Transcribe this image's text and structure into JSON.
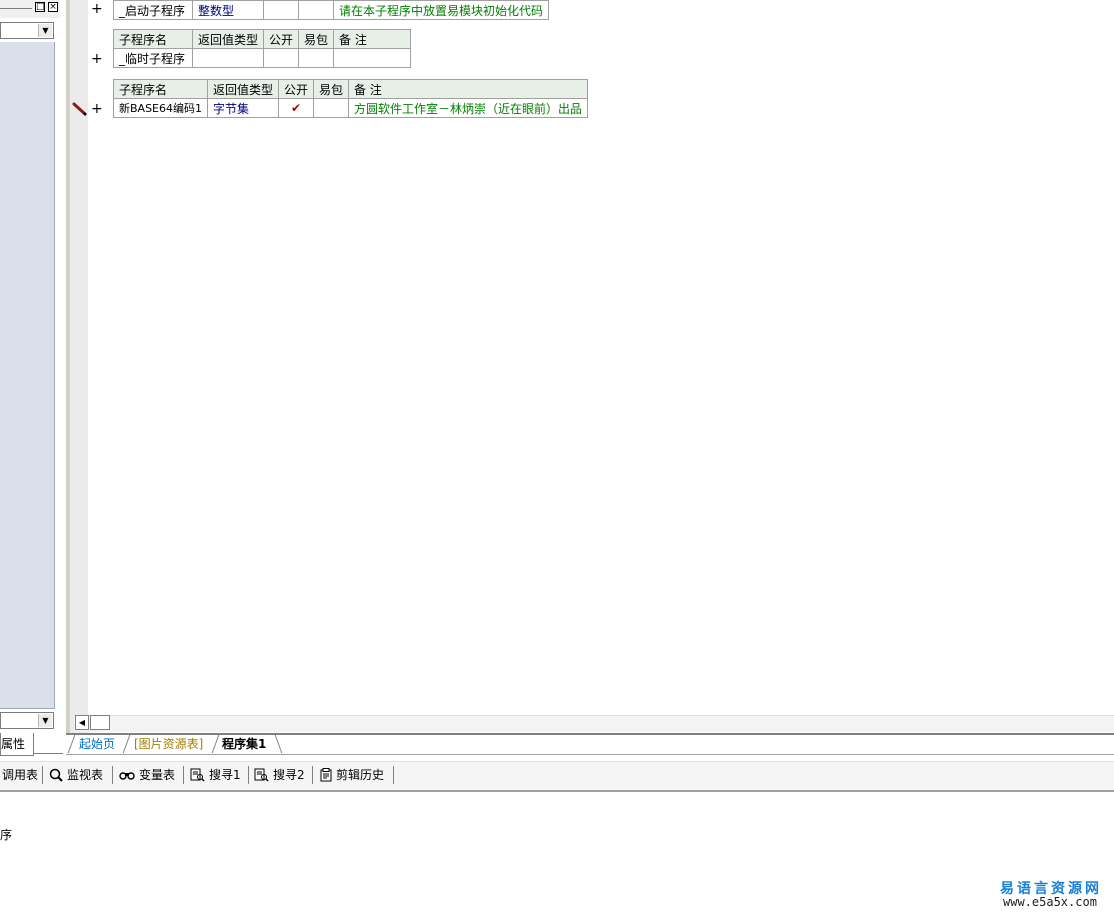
{
  "left_panel": {
    "properties_tab": "属性"
  },
  "editor": {
    "headers": {
      "sub_name": "子程序名",
      "return_type": "返回值类型",
      "public": "公开",
      "easy_pack": "易包",
      "note": "备 注"
    },
    "subs": [
      {
        "name": "_启动子程序",
        "return_type": "整数型",
        "public": "",
        "easy_pack": "",
        "note": "请在本子程序中放置易模块初始化代码"
      },
      {
        "name": "_临时子程序",
        "return_type": "",
        "public": "",
        "easy_pack": "",
        "note": ""
      },
      {
        "name": "新BASE64编码1",
        "return_type": "字节集",
        "public": "✔",
        "easy_pack": "",
        "note": "方圆软件工作室－林炳崇（近在眼前）出品"
      }
    ],
    "expand_symbol": "+"
  },
  "tabs": [
    {
      "label": "起始页"
    },
    {
      "label": "[图片资源表]"
    },
    {
      "label": "程序集1"
    }
  ],
  "toolbar": {
    "items": [
      {
        "label": "调用表",
        "icon": "none"
      },
      {
        "label": "监视表",
        "icon": "magnifier-icon"
      },
      {
        "label": "变量表",
        "icon": "binoculars-icon"
      },
      {
        "label": "搜寻1",
        "icon": "search-doc-icon"
      },
      {
        "label": "搜寻2",
        "icon": "search-doc-icon"
      },
      {
        "label": "剪辑历史",
        "icon": "clipboard-icon"
      }
    ]
  },
  "output": {
    "line": "序"
  },
  "watermark": {
    "title": "易语言资源网",
    "url": "www.e5a5x.com"
  },
  "colors": {
    "note_green": "#008000",
    "type_navy": "#000080",
    "check_red": "#b00000",
    "left_list_bg": "#d9e0ea",
    "watermark_blue": "#1a7fd6"
  }
}
